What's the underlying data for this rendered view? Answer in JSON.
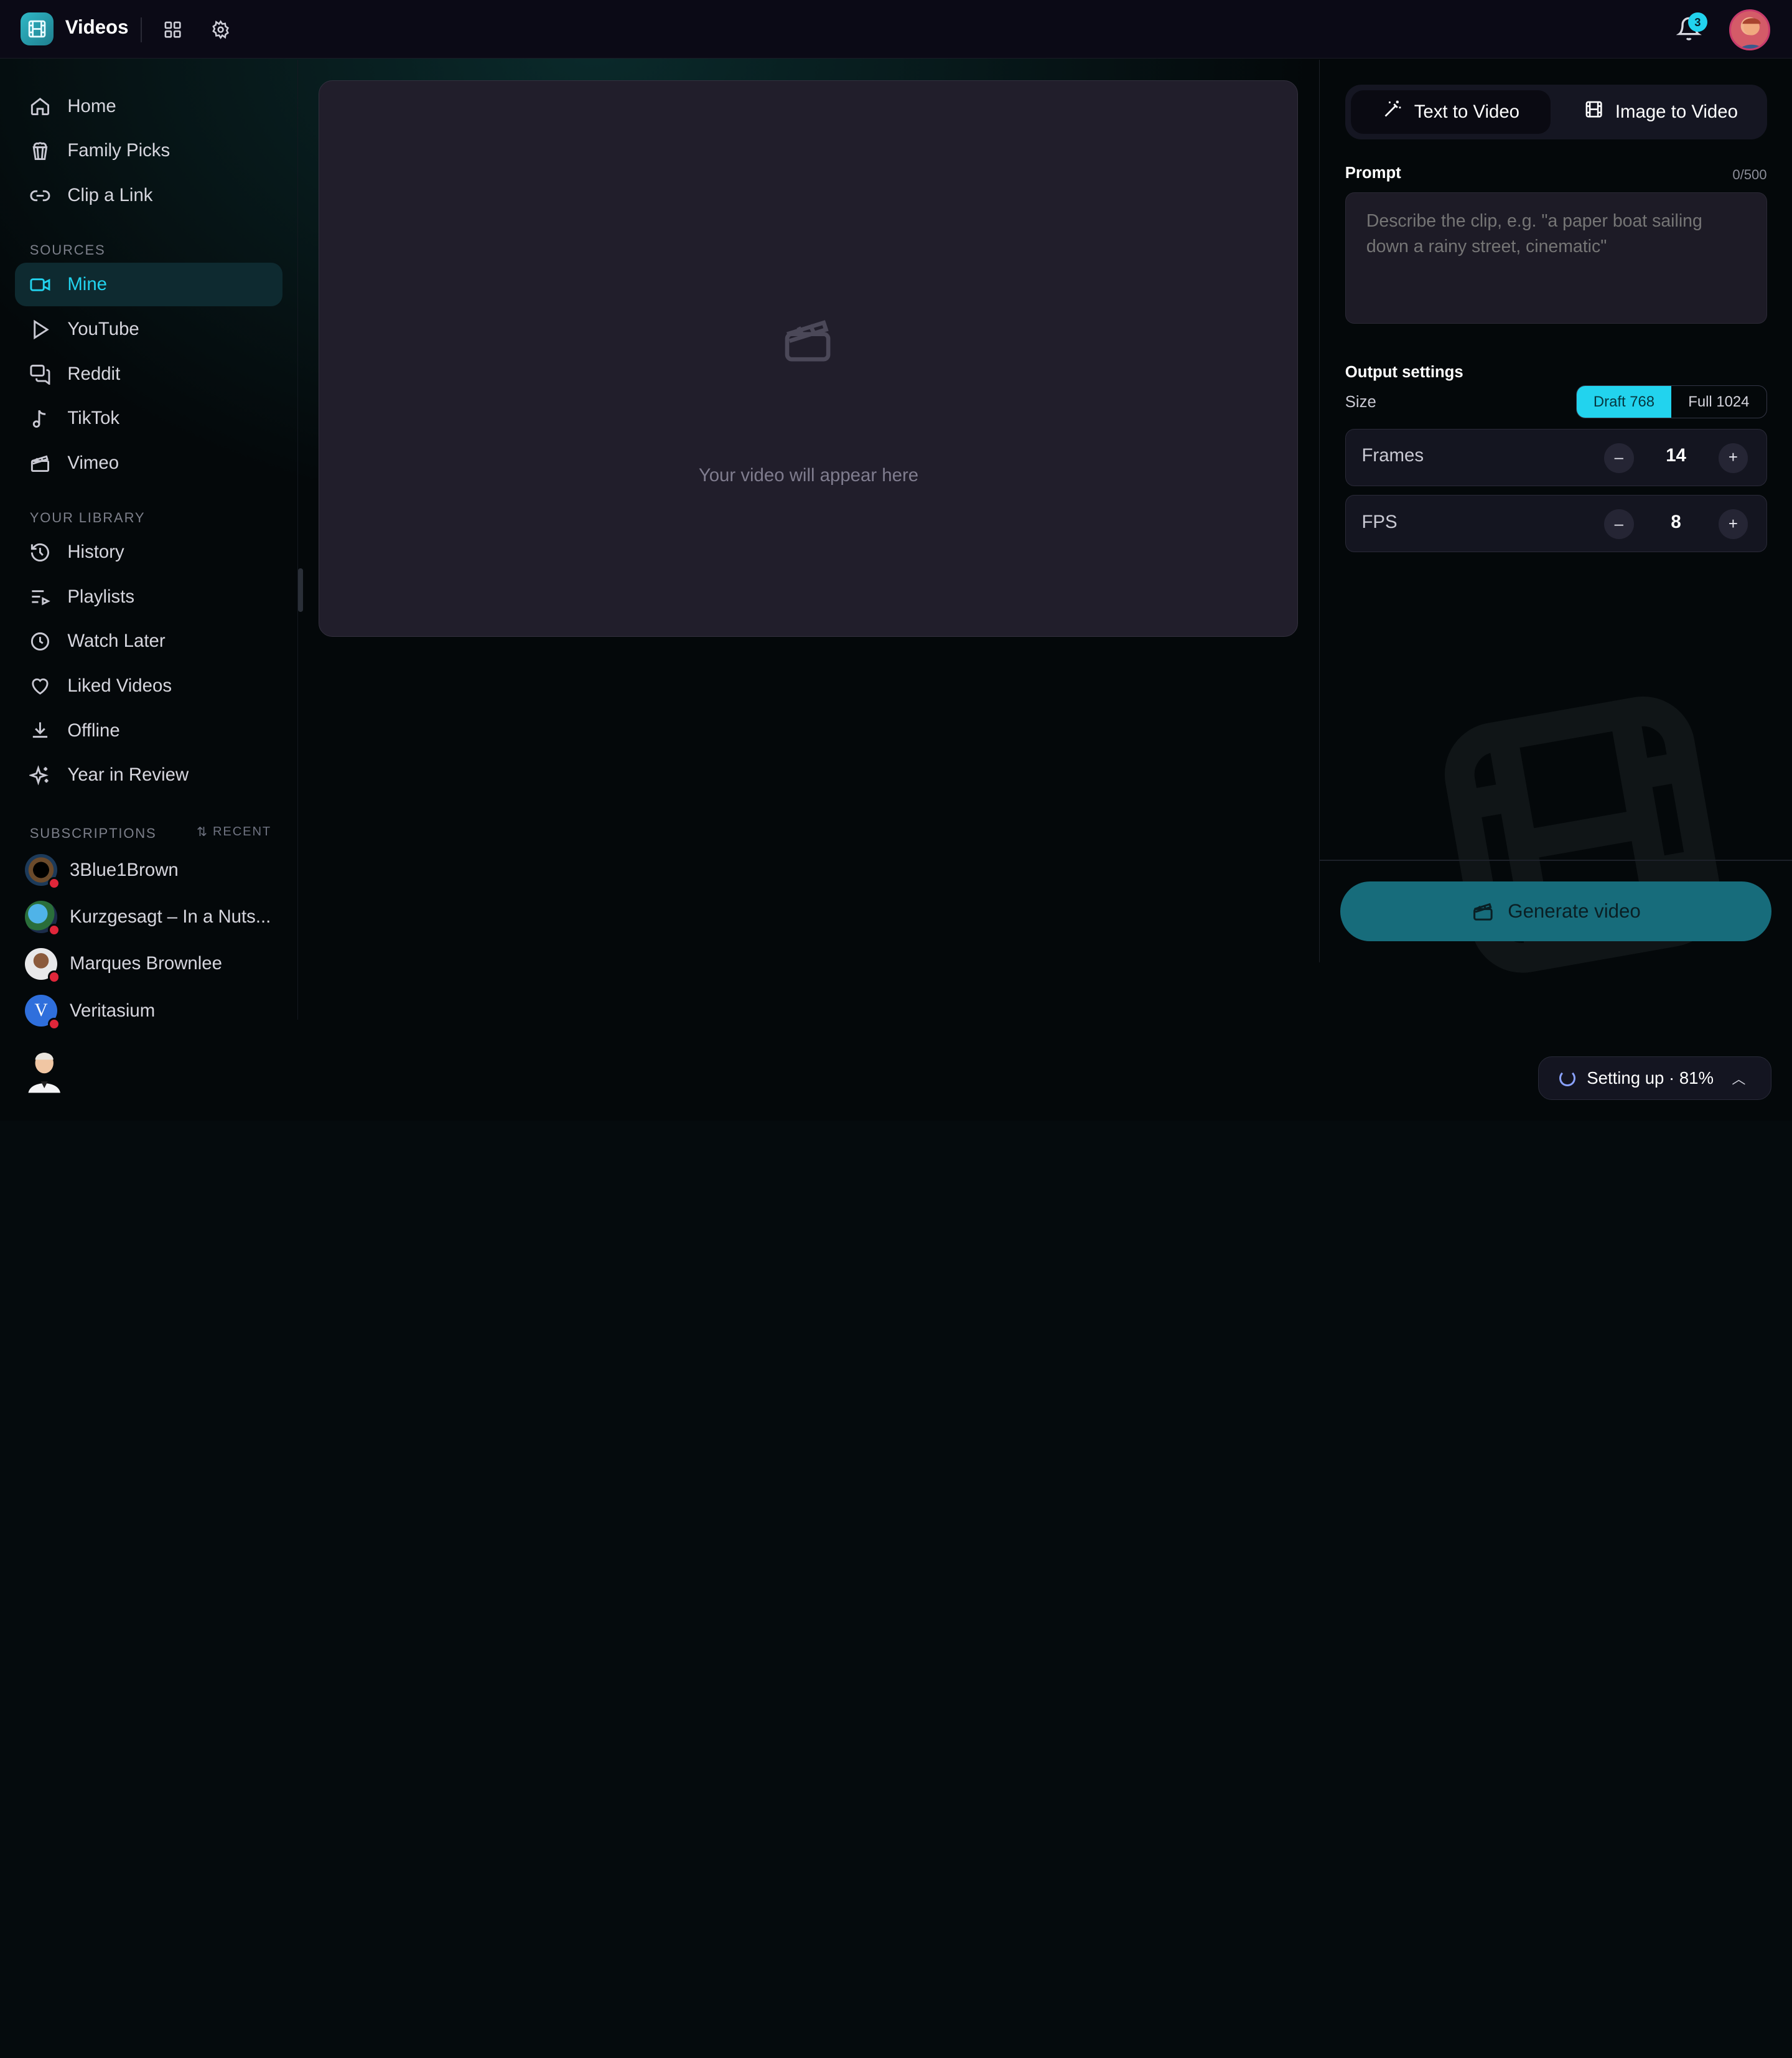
{
  "app": {
    "title": "Videos",
    "notifications_count": "3"
  },
  "sidebar": {
    "main_items": [
      {
        "label": "Home",
        "icon": "home-icon"
      },
      {
        "label": "Family Picks",
        "icon": "popcorn-icon"
      },
      {
        "label": "Clip a Link",
        "icon": "link-icon"
      }
    ],
    "sources_label": "SOURCES",
    "sources": [
      {
        "label": "Mine",
        "icon": "video-camera-icon",
        "active": true
      },
      {
        "label": "YouTube",
        "icon": "play-icon"
      },
      {
        "label": "Reddit",
        "icon": "chat-icon"
      },
      {
        "label": "TikTok",
        "icon": "music-note-icon"
      },
      {
        "label": "Vimeo",
        "icon": "clapperboard-icon"
      }
    ],
    "library_label": "YOUR LIBRARY",
    "library": [
      {
        "label": "History",
        "icon": "history-icon"
      },
      {
        "label": "Playlists",
        "icon": "playlist-icon"
      },
      {
        "label": "Watch Later",
        "icon": "clock-icon"
      },
      {
        "label": "Liked Videos",
        "icon": "heart-icon"
      },
      {
        "label": "Offline",
        "icon": "download-icon"
      },
      {
        "label": "Year in Review",
        "icon": "sparkles-icon"
      }
    ],
    "subscriptions_label": "SUBSCRIPTIONS",
    "recent_label": "RECENT",
    "subscriptions": [
      {
        "label": "3Blue1Brown"
      },
      {
        "label": "Kurzgesagt – In a Nuts..."
      },
      {
        "label": "Marques Brownlee"
      },
      {
        "label": "Veritasium"
      }
    ]
  },
  "preview": {
    "empty_message": "Your video will appear here"
  },
  "panel": {
    "tabs": [
      {
        "label": "Text to Video",
        "icon": "magic-wand-icon",
        "active": true
      },
      {
        "label": "Image to Video",
        "icon": "film-icon",
        "active": false
      }
    ],
    "prompt_label": "Prompt",
    "prompt_counter": "0/500",
    "prompt_placeholder": "Describe the clip, e.g. \"a paper boat sailing down a rainy street, cinematic\"",
    "output_settings_label": "Output settings",
    "size_label": "Size",
    "size_options": [
      {
        "label": "Draft 768",
        "selected": true
      },
      {
        "label": "Full 1024",
        "selected": false
      }
    ],
    "frames": {
      "label": "Frames",
      "value": "14",
      "decrement": "–",
      "increment": "+"
    },
    "fps": {
      "label": "FPS",
      "value": "8",
      "decrement": "–",
      "increment": "+"
    },
    "generate_label": "Generate video"
  },
  "status": {
    "text": "Setting up · 81%"
  },
  "colors": {
    "accent": "#22d3ee",
    "card": "#211e2b",
    "generate": "#176c7b"
  }
}
